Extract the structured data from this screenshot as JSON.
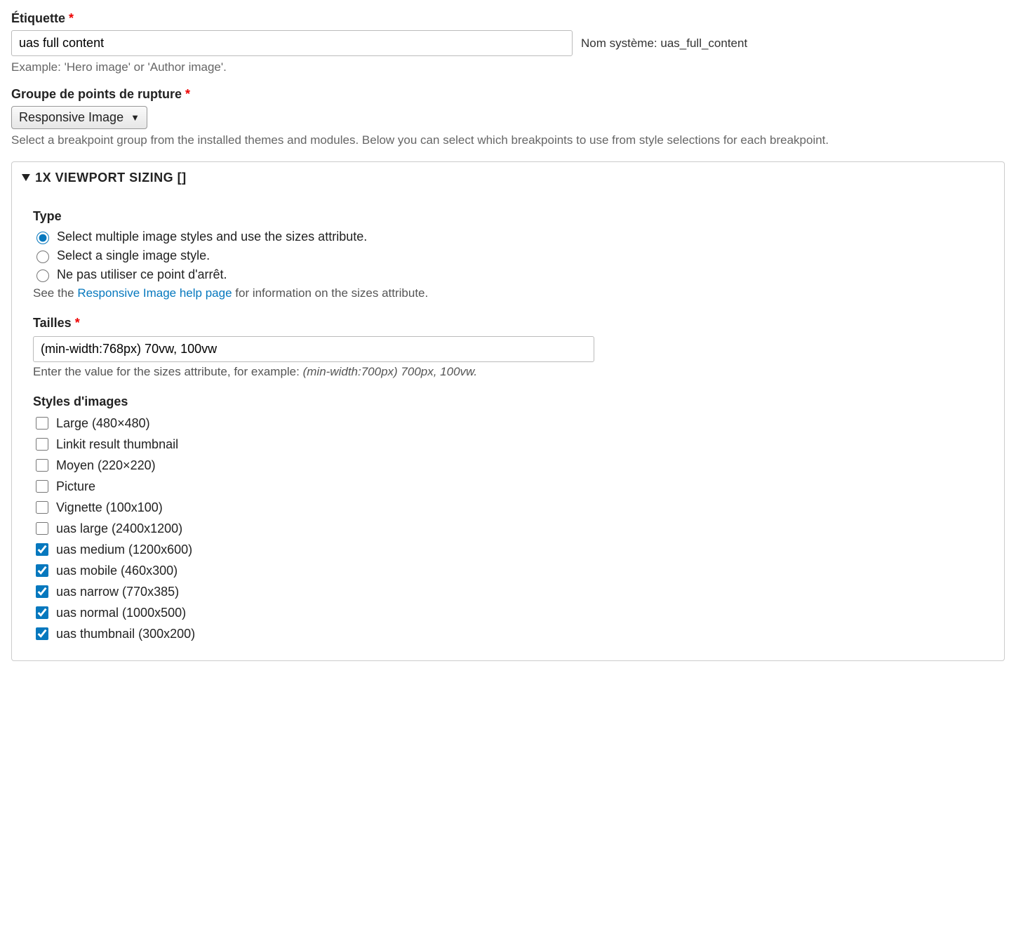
{
  "etiquette": {
    "label": "Étiquette",
    "value": "uas full content",
    "help": "Example: 'Hero image' or 'Author image'.",
    "machine_name_label": "Nom système:",
    "machine_name_value": "uas_full_content"
  },
  "breakpoint_group": {
    "label": "Groupe de points de rupture",
    "selected": "Responsive Image",
    "help": "Select a breakpoint group from the installed themes and modules. Below you can select which breakpoints to use from style selections for each breakpoint."
  },
  "viewport": {
    "summary": "1X VIEWPORT SIZING []",
    "type": {
      "label": "Type",
      "options": [
        {
          "label": "Select multiple image styles and use the sizes attribute.",
          "selected": true
        },
        {
          "label": "Select a single image style.",
          "selected": false
        },
        {
          "label": "Ne pas utiliser ce point d'arrêt.",
          "selected": false
        }
      ],
      "help_prefix": "See the ",
      "help_link": "Responsive Image help page",
      "help_suffix": " for information on the sizes attribute."
    },
    "tailles": {
      "label": "Tailles",
      "value": "(min-width:768px) 70vw, 100vw",
      "help_prefix": "Enter the value for the sizes attribute, for example: ",
      "help_example": "(min-width:700px) 700px, 100vw."
    },
    "styles": {
      "label": "Styles d'images",
      "items": [
        {
          "label": "Large (480×480)",
          "checked": false
        },
        {
          "label": "Linkit result thumbnail",
          "checked": false
        },
        {
          "label": "Moyen (220×220)",
          "checked": false
        },
        {
          "label": "Picture",
          "checked": false
        },
        {
          "label": "Vignette (100x100)",
          "checked": false
        },
        {
          "label": "uas large (2400x1200)",
          "checked": false
        },
        {
          "label": "uas medium (1200x600)",
          "checked": true
        },
        {
          "label": "uas mobile (460x300)",
          "checked": true
        },
        {
          "label": "uas narrow (770x385)",
          "checked": true
        },
        {
          "label": "uas normal (1000x500)",
          "checked": true
        },
        {
          "label": "uas thumbnail (300x200)",
          "checked": true
        }
      ]
    }
  }
}
